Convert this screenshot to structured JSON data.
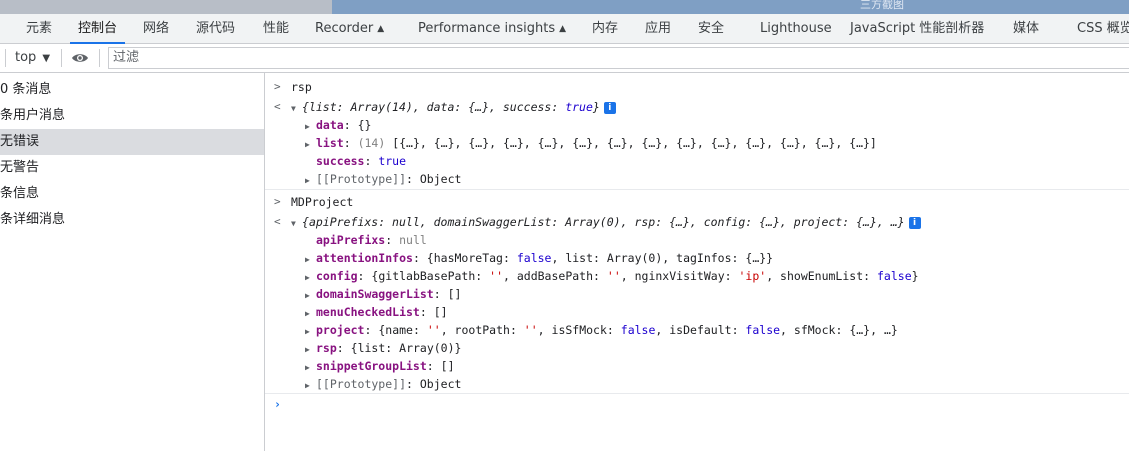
{
  "top_strip": {
    "text": "三方截图"
  },
  "tabs": [
    {
      "label": "元素"
    },
    {
      "label": "控制台"
    },
    {
      "label": "网络"
    },
    {
      "label": "源代码"
    },
    {
      "label": "性能"
    },
    {
      "label": "Recorder"
    },
    {
      "label": "Performance insights"
    },
    {
      "label": "内存"
    },
    {
      "label": "应用"
    },
    {
      "label": "安全"
    },
    {
      "label": "Lighthouse"
    },
    {
      "label": "JavaScript 性能剖析器"
    },
    {
      "label": "媒体"
    },
    {
      "label": "CSS 概览"
    }
  ],
  "toolbar": {
    "context": "top",
    "filter_placeholder": "过滤"
  },
  "sidebar": {
    "items": [
      {
        "label": "0 条消息"
      },
      {
        "label": " 条用户消息"
      },
      {
        "label": "无错误"
      },
      {
        "label": "无警告"
      },
      {
        "label": " 条信息"
      },
      {
        "label": " 条详细消息"
      }
    ]
  },
  "console": {
    "cmd1": "rsp",
    "res1": {
      "summary": {
        "p1": "{",
        "k1": "list",
        "v1": "Array(14)",
        "p2": ", ",
        "k2": "data",
        "v2": "{…}",
        "p3": ", ",
        "k3": "success",
        "v3": "true",
        "p4": "}"
      },
      "data_key": "data",
      "data_val": "{}",
      "list_key": "list",
      "list_count": "(14)",
      "list_val": "[{…}, {…}, {…}, {…}, {…}, {…}, {…}, {…}, {…}, {…}, {…}, {…}, {…}, {…}]",
      "success_key": "success",
      "success_val": "true",
      "proto_key": "[[Prototype]]",
      "proto_val": "Object"
    },
    "cmd2": "MDProject",
    "res2": {
      "summary": {
        "p1": "{",
        "k1": "apiPrefixs",
        "v1": "null",
        "p2": ", ",
        "k2": "domainSwaggerList",
        "v2": "Array(0)",
        "p3": ", ",
        "k3": "rsp",
        "v3": "{…}",
        "p4": ", ",
        "k4": "config",
        "v4": "{…}",
        "p5": ", ",
        "k5": "project",
        "v5": "{…}",
        "p6": ", …}"
      },
      "apiPrefixs_key": "apiPrefixs",
      "apiPrefixs_val": "null",
      "attention_key": "attentionInfos",
      "attention_p1": "{",
      "attention_k1": "hasMoreTag",
      "attention_v1": "false",
      "attention_p2": ", ",
      "attention_k2": "list",
      "attention_v2": "Array(0)",
      "attention_p3": ", ",
      "attention_k3": "tagInfos",
      "attention_v3": "{…}",
      "attention_p4": "}",
      "config_key": "config",
      "config_p1": "{",
      "config_k1": "gitlabBasePath",
      "config_v1": "''",
      "config_p2": ", ",
      "config_k2": "addBasePath",
      "config_v2": "''",
      "config_p3": ", ",
      "config_k3": "nginxVisitWay",
      "config_v3": "'ip'",
      "config_p4": ", ",
      "config_k4": "showEnumList",
      "config_v4": "false",
      "config_p5": "}",
      "domain_key": "domainSwaggerList",
      "domain_val": "[]",
      "menu_key": "menuCheckedList",
      "menu_val": "[]",
      "project_key": "project",
      "project_p1": "{",
      "project_k1": "name",
      "project_v1": "''",
      "project_p2": ", ",
      "project_k2": "rootPath",
      "project_v2": "''",
      "project_p3": ", ",
      "project_k3": "isSfMock",
      "project_v3": "false",
      "project_p4": ", ",
      "project_k4": "isDefault",
      "project_v4": "false",
      "project_p5": ", ",
      "project_k5": "sfMock",
      "project_v5": "{…}",
      "project_p6": ", …}",
      "rsp_key": "rsp",
      "rsp_p1": "{",
      "rsp_k1": "list",
      "rsp_v1": "Array(0)",
      "rsp_p2": "}",
      "snippet_key": "snippetGroupList",
      "snippet_val": "[]",
      "proto_key": "[[Prototype]]",
      "proto_val": "Object"
    },
    "prompt": "›"
  }
}
